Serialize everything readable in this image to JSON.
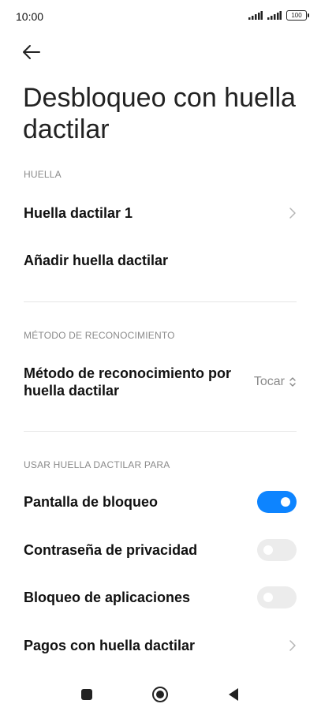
{
  "status_bar": {
    "time": "10:00",
    "battery": "100"
  },
  "header": {
    "title": "Desbloqueo con huella dactilar"
  },
  "sections": {
    "fingerprint": "HUELLA",
    "method": "MÉTODO DE RECONOCIMIENTO",
    "use_for": "USAR HUELLA DACTILAR PARA"
  },
  "items": {
    "fingerprint1": "Huella dactilar 1",
    "add_fingerprint": "Añadir huella dactilar",
    "method_label": "Método de reconocimiento por huella dactilar",
    "method_value": "Tocar",
    "lock_screen": "Pantalla de bloqueo",
    "privacy_password": "Contraseña de privacidad",
    "app_lock": "Bloqueo de aplicaciones",
    "payments": "Pagos con huella dactilar"
  },
  "toggles": {
    "lock_screen": true,
    "privacy_password": false,
    "app_lock": false
  },
  "colors": {
    "accent": "#0d84ff",
    "toggle_off": "#ececec"
  }
}
